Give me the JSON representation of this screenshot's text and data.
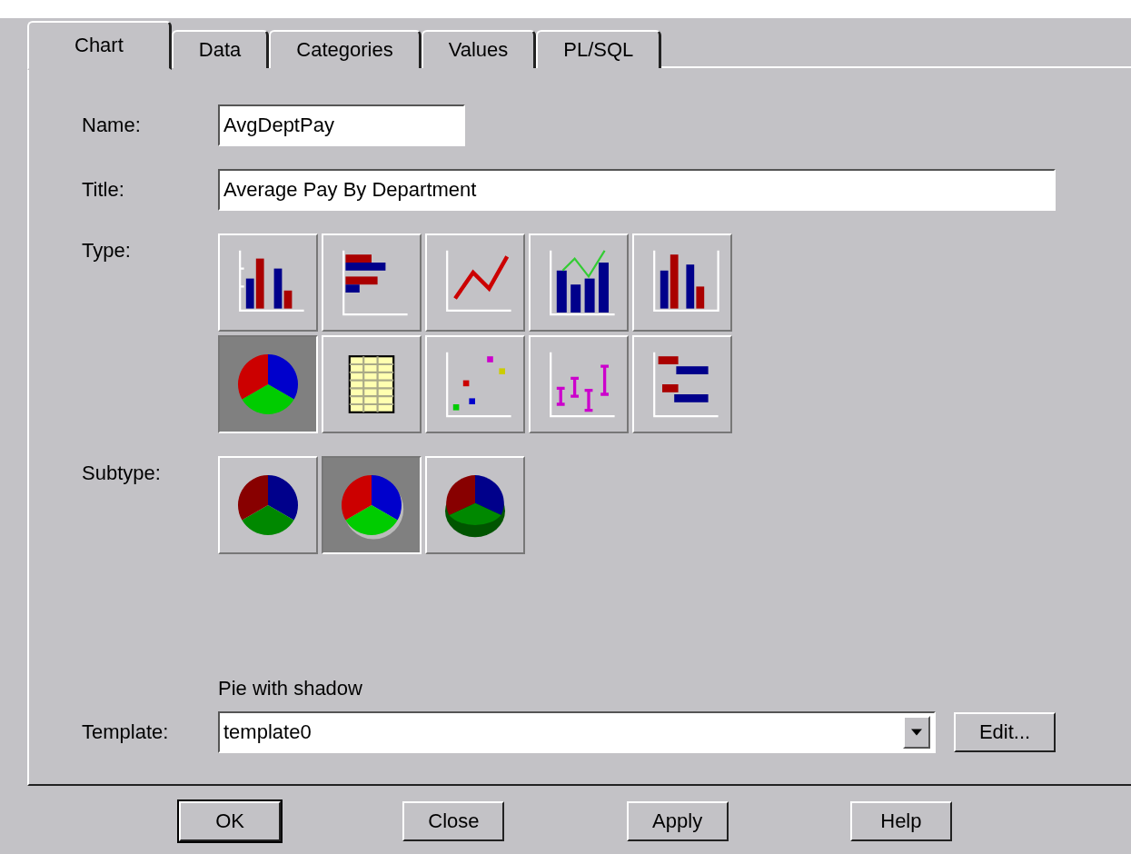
{
  "tabs": [
    {
      "label": "Chart",
      "selected": true
    },
    {
      "label": "Data",
      "selected": false
    },
    {
      "label": "Categories",
      "selected": false
    },
    {
      "label": "Values",
      "selected": false
    },
    {
      "label": "PL/SQL",
      "selected": false
    }
  ],
  "name_field": {
    "label": "Name:",
    "value": "AvgDeptPay"
  },
  "title_field": {
    "label": "Title:",
    "value": "Average Pay By Department"
  },
  "type": {
    "label": "Type:",
    "options": [
      {
        "kind": "column",
        "selected": false
      },
      {
        "kind": "bar",
        "selected": false
      },
      {
        "kind": "line",
        "selected": false
      },
      {
        "kind": "combo",
        "selected": false
      },
      {
        "kind": "dual_axis",
        "selected": false
      },
      {
        "kind": "pie",
        "selected": true
      },
      {
        "kind": "table",
        "selected": false
      },
      {
        "kind": "scatter",
        "selected": false
      },
      {
        "kind": "high_low",
        "selected": false
      },
      {
        "kind": "gantt",
        "selected": false
      }
    ]
  },
  "subtype": {
    "label": "Subtype:",
    "options": [
      {
        "kind": "pie_plain",
        "selected": false
      },
      {
        "kind": "pie_shadow",
        "selected": true
      },
      {
        "kind": "pie_3d",
        "selected": false
      }
    ]
  },
  "subtype_description": "Pie with shadow",
  "template": {
    "label": "Template:",
    "value": "template0",
    "edit_button": {
      "label": "Edit..."
    }
  },
  "buttons": [
    {
      "label": "OK",
      "default": true
    },
    {
      "label": "Close",
      "default": false
    },
    {
      "label": "Apply",
      "default": false
    },
    {
      "label": "Help",
      "default": false
    }
  ]
}
